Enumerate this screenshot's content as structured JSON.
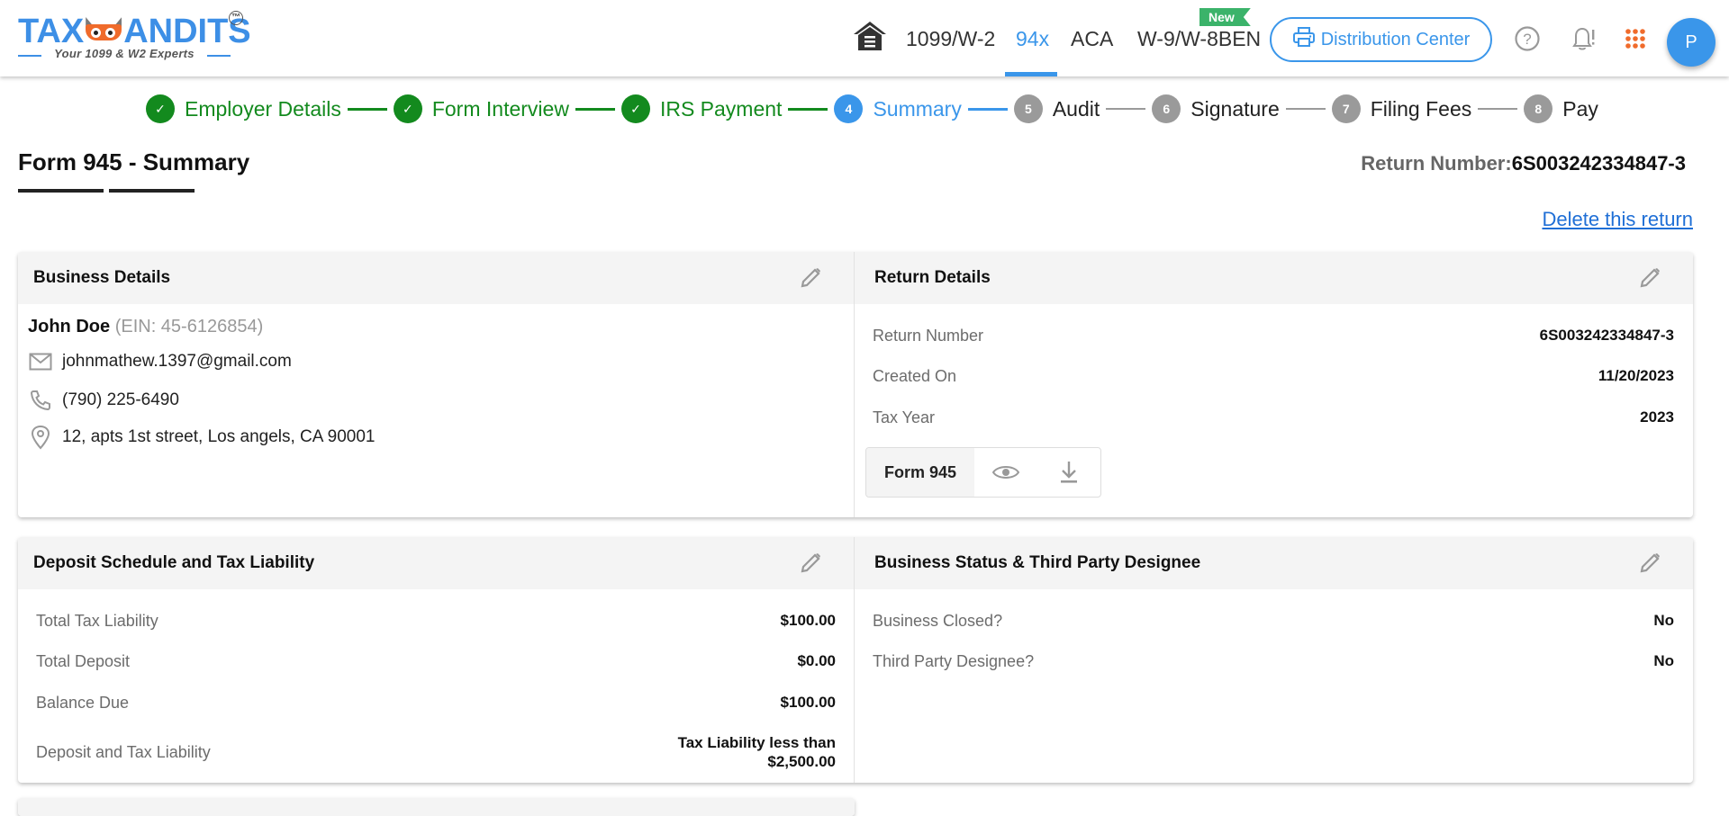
{
  "brand": {
    "name_left": "TAX",
    "name_right": "ANDITS",
    "trademark": "TM",
    "tagline": "Your 1099 & W2 Experts"
  },
  "nav": {
    "home_icon": "home-icon",
    "links": [
      {
        "label": "1099/W-2",
        "active": false
      },
      {
        "label": "94x",
        "active": true
      },
      {
        "label": "ACA",
        "active": false
      },
      {
        "label": "W-9/W-8BEN",
        "active": false
      }
    ],
    "new_badge": "New",
    "distribution_center": "Distribution Center",
    "help_icon": "help-icon",
    "notification_icon": "bell-icon",
    "apps_icon": "apps-grid-icon",
    "avatar_initial": "P"
  },
  "stepper": {
    "steps": [
      {
        "number": "1",
        "label": "Employer Details",
        "status": "done"
      },
      {
        "number": "2",
        "label": "Form Interview",
        "status": "done"
      },
      {
        "number": "3",
        "label": "IRS Payment",
        "status": "done"
      },
      {
        "number": "4",
        "label": "Summary",
        "status": "current"
      },
      {
        "number": "5",
        "label": "Audit",
        "status": "todo"
      },
      {
        "number": "6",
        "label": "Signature",
        "status": "todo"
      },
      {
        "number": "7",
        "label": "Filing Fees",
        "status": "todo"
      },
      {
        "number": "8",
        "label": "Pay",
        "status": "todo"
      }
    ]
  },
  "page": {
    "title": "Form 945 - Summary",
    "return_number_label": "Return Number:",
    "return_number_value": "6S003242334847-3",
    "delete_link": "Delete this return"
  },
  "business_details": {
    "title": "Business Details",
    "name": "John Doe",
    "ein": "(EIN: 45-6126854)",
    "email": "johnmathew.1397@gmail.com",
    "phone": "(790) 225-6490",
    "address": "12, apts 1st street, Los angels, CA 90001"
  },
  "return_details": {
    "title": "Return Details",
    "rows": [
      {
        "label": "Return Number",
        "value": "6S003242334847-3"
      },
      {
        "label": "Created On",
        "value": "11/20/2023"
      },
      {
        "label": "Tax Year",
        "value": "2023"
      }
    ],
    "form_label": "Form 945"
  },
  "deposit_schedule": {
    "title": "Deposit Schedule and Tax Liability",
    "rows": [
      {
        "label": "Total Tax Liability",
        "value": "$100.00"
      },
      {
        "label": "Total Deposit",
        "value": "$0.00"
      },
      {
        "label": "Balance Due",
        "value": "$100.00"
      },
      {
        "label": "Deposit and Tax Liability",
        "value_line1": "Tax Liability less than",
        "value_line2": "$2,500.00"
      }
    ]
  },
  "business_status": {
    "title": "Business Status & Third Party Designee",
    "rows": [
      {
        "label": "Business Closed?",
        "value": "No"
      },
      {
        "label": "Third Party Designee?",
        "value": "No"
      }
    ]
  },
  "colors": {
    "primary_blue": "#3a96ea",
    "success_green": "#138a1e",
    "inactive_gray": "#9a9a9a",
    "brand_orange": "#f06b2b",
    "new_badge_green": "#3bb36a",
    "link_blue": "#1f6fd6"
  }
}
